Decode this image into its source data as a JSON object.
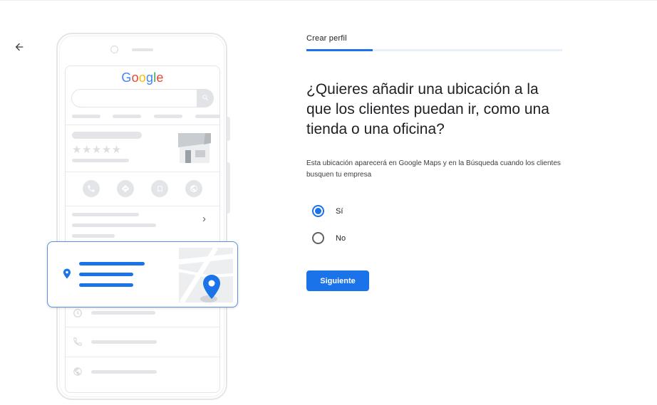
{
  "nav": {
    "back_icon": "arrow-back-icon"
  },
  "illustration": {
    "logo_letters": [
      {
        "char": "G",
        "color": "#4285F4"
      },
      {
        "char": "o",
        "color": "#EA4335"
      },
      {
        "char": "o",
        "color": "#FBBC05"
      },
      {
        "char": "g",
        "color": "#4285F4"
      },
      {
        "char": "l",
        "color": "#34A853"
      },
      {
        "char": "e",
        "color": "#EA4335"
      }
    ],
    "stars": "★★★★★",
    "action_icons": [
      "phone-icon",
      "directions-icon",
      "bookmark-icon",
      "globe-icon"
    ],
    "card_icon": "location-pin-icon",
    "map_pin_color": "#1a73e8"
  },
  "form": {
    "step_label": "Crear perfil",
    "progress": 0.26,
    "title": "¿Quieres añadir una ubicación a la que los clientes puedan ir, como una tienda o una oficina?",
    "description": "Esta ubicación aparecerá en Google Maps y en la Búsqueda cuando los clientes busquen tu empresa",
    "options": [
      {
        "label": "Sí",
        "selected": true
      },
      {
        "label": "No",
        "selected": false
      }
    ],
    "next_label": "Siguiente"
  },
  "colors": {
    "accent": "#1a73e8",
    "text": "#202124",
    "placeholder_gray": "#e3e5e8"
  }
}
